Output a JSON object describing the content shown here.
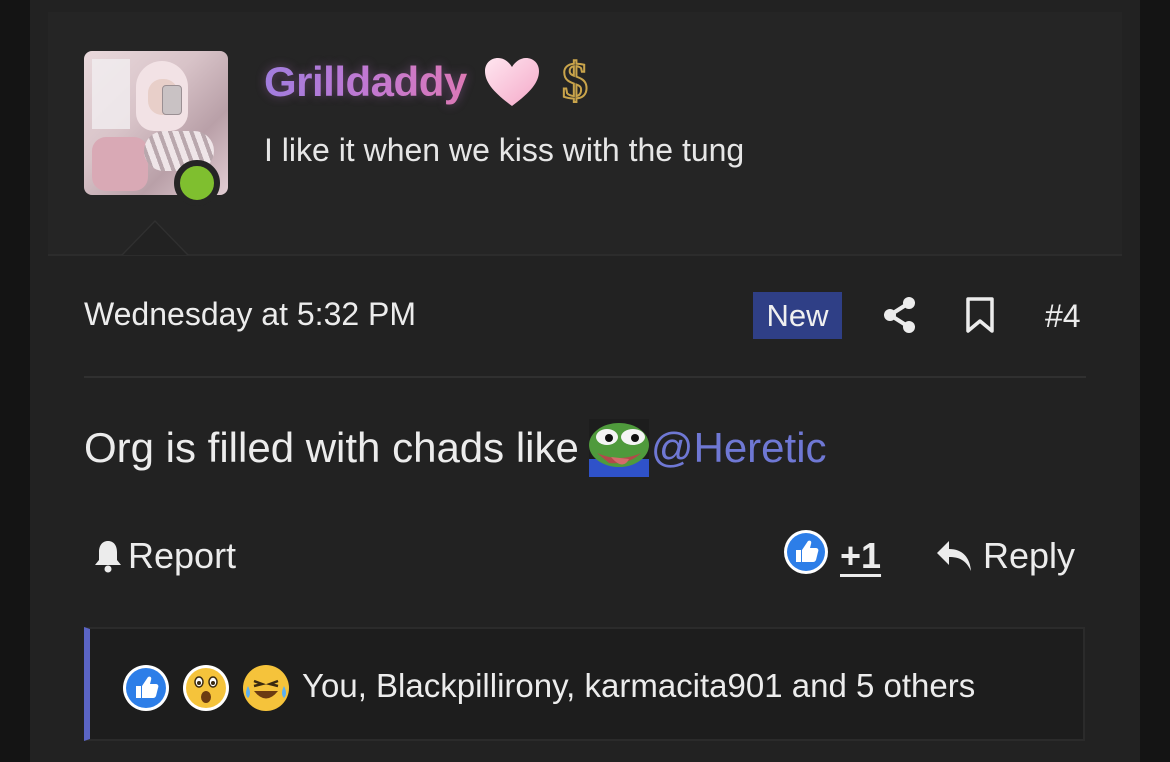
{
  "post": {
    "author": {
      "username": "Grilldaddy",
      "tagline": "I like it when we kiss with the tung",
      "online": true,
      "icons": [
        "avatar-photo",
        "heart-icon",
        "dollar-icon",
        "online-status-dot"
      ]
    },
    "meta": {
      "timestamp": "Wednesday at 5:32 PM",
      "badge": "New",
      "post_number": "#4"
    },
    "message": {
      "text": "Org is filled with chads like",
      "emoji": "pepe-emoji",
      "mention": "@Heretic"
    },
    "actions": {
      "report_label": "Report",
      "like_count": "+1",
      "reply_label": "Reply"
    },
    "reactions": {
      "icons": [
        "like-reaction-icon",
        "wow-reaction-icon",
        "laugh-reaction-icon"
      ],
      "summary": "You, Blackpillirony, karmacita901 and 5 others"
    }
  },
  "colors": {
    "background": "#141414",
    "card": "#222222",
    "header": "#252525",
    "accent": "#2f3f86",
    "mention": "#6f78d4",
    "online": "#7fbf2f",
    "reaction_border": "#5a64c4"
  }
}
